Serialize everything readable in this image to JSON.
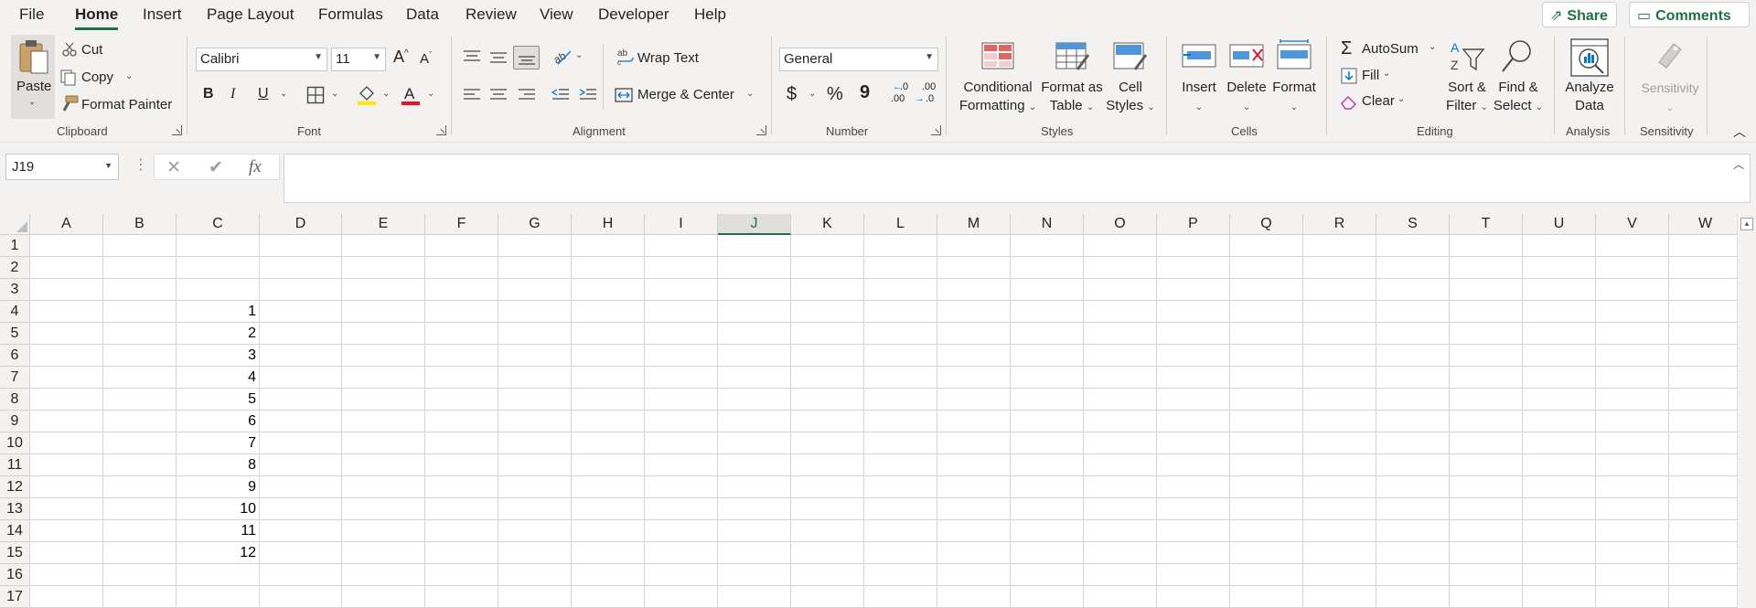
{
  "menu": {
    "tabs": [
      "File",
      "Home",
      "Insert",
      "Page Layout",
      "Formulas",
      "Data",
      "Review",
      "View",
      "Developer",
      "Help"
    ],
    "active": "Home",
    "share_label": "Share",
    "comments_label": "Comments"
  },
  "ribbon": {
    "clipboard": {
      "paste": "Paste",
      "cut": "Cut",
      "copy": "Copy",
      "format_painter": "Format Painter",
      "label": "Clipboard"
    },
    "font": {
      "name": "Calibri",
      "size": "11",
      "bold": "B",
      "italic": "I",
      "underline": "U",
      "label": "Font"
    },
    "alignment": {
      "wrap_text": "Wrap Text",
      "merge_center": "Merge & Center",
      "label": "Alignment"
    },
    "number": {
      "format": "General",
      "currency": "$",
      "percent": "%",
      "comma": "9",
      "inc_decimal_top": ".0",
      "inc_decimal_bottom": ".00",
      "dec_decimal_top": ".00",
      "dec_decimal_bottom": ".0",
      "label": "Number"
    },
    "styles": {
      "conditional_1": "Conditional",
      "conditional_2": "Formatting",
      "format_table_1": "Format as",
      "format_table_2": "Table",
      "cell_styles_1": "Cell",
      "cell_styles_2": "Styles",
      "label": "Styles"
    },
    "cells": {
      "insert": "Insert",
      "delete": "Delete",
      "format": "Format",
      "label": "Cells"
    },
    "editing": {
      "autosum": "AutoSum",
      "fill": "Fill",
      "clear": "Clear",
      "sort_1": "Sort &",
      "sort_2": "Filter",
      "find_1": "Find &",
      "find_2": "Select",
      "label": "Editing"
    },
    "analysis": {
      "analyze_1": "Analyze",
      "analyze_2": "Data",
      "label": "Analysis"
    },
    "sensitivity": {
      "button": "Sensitivity",
      "label": "Sensitivity"
    }
  },
  "formula_bar": {
    "name_box": "J19",
    "cancel": "✕",
    "enter": "✔",
    "fx": "fx",
    "value": ""
  },
  "sheet": {
    "columns": [
      "A",
      "B",
      "C",
      "D",
      "E",
      "F",
      "G",
      "H",
      "I",
      "J",
      "K",
      "L",
      "M",
      "N",
      "O",
      "P",
      "Q",
      "R",
      "S",
      "T",
      "U",
      "V",
      "W"
    ],
    "selected_column": "J",
    "rows": [
      "1",
      "2",
      "3",
      "4",
      "5",
      "6",
      "7",
      "8",
      "9",
      "10",
      "11",
      "12",
      "13",
      "14",
      "15",
      "16",
      "17"
    ],
    "column_c_values": [
      "",
      "",
      "",
      "1",
      "2",
      "3",
      "4",
      "5",
      "6",
      "7",
      "8",
      "9",
      "10",
      "11",
      "12",
      "",
      ""
    ]
  },
  "colors": {
    "accent": "#1e7145",
    "grid": "#d4d4d4",
    "ribbon_bg": "#f3f2f1"
  }
}
